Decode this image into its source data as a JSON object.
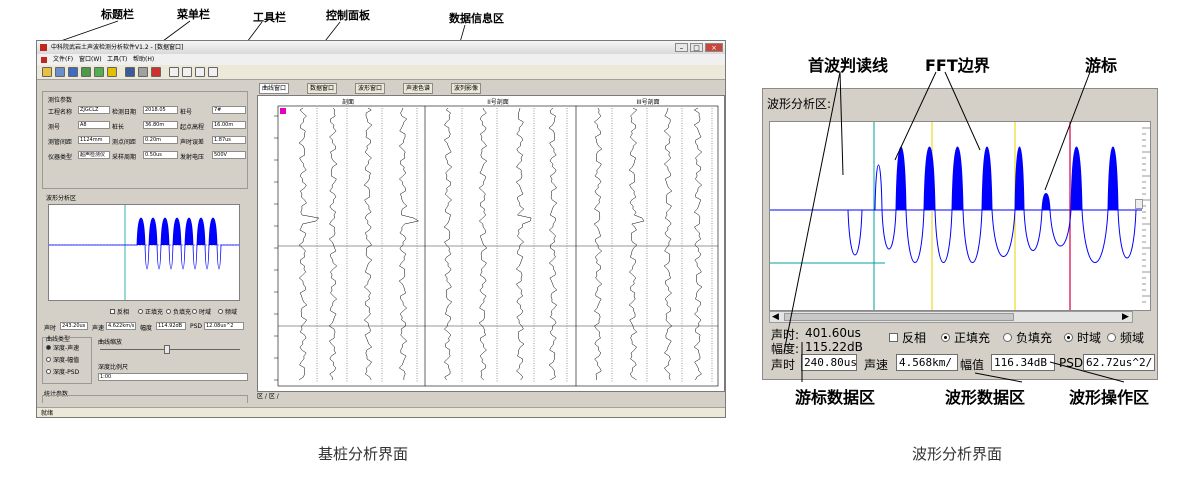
{
  "annotations_left": {
    "title_bar": "标题栏",
    "menu_bar": "菜单栏",
    "toolbar": "工具栏",
    "control_panel": "控制面板",
    "data_info_area": "数据信息区"
  },
  "annotations_right": {
    "first_wave_line": "首波判读线",
    "fft_boundary": "FFT边界",
    "cursor": "游标",
    "cursor_data_area": "游标数据区",
    "wave_data_area": "波形数据区",
    "wave_operation_area": "波形操作区"
  },
  "captions": {
    "left": "基桩分析界面",
    "right": "波形分析界面"
  },
  "left_window": {
    "title": "中科院武岩土声波检测分析软件V1.2 - [数据窗口]",
    "menu": [
      "文件(F)",
      "窗口(W)",
      "工具(T)",
      "帮助(H)"
    ],
    "control": {
      "params_heading": "测位参数",
      "rows": [
        [
          "工程名称",
          "ZJGCLZ",
          "检测日期",
          "2018.05",
          "桩号",
          "7#"
        ],
        [
          "测号",
          "A8",
          "桩长",
          "36.80m",
          "起点高程",
          "16.00m"
        ],
        [
          "测管间距",
          "1124mm",
          "测点间距",
          "0.20m",
          "声时误差",
          "1.87us"
        ],
        [
          "仪器类型",
          "超声检测仪",
          "采样周期",
          "0.50us",
          "发射电压",
          "500V"
        ]
      ],
      "wave_heading": "波形分析区",
      "options": [
        "反相",
        "正填充",
        "负填充",
        "时域",
        "频域"
      ],
      "readout": [
        "声时",
        "243.20us",
        "声速",
        "4.622km/s",
        "幅度",
        "114.92dB",
        "PSD",
        "12.08us^2"
      ],
      "curve_group": "曲线类型",
      "curve_options": [
        "深度-声速",
        "深度-幅值",
        "深度-PSD"
      ],
      "scale_label": "曲线缩放",
      "ratio_label": "深度比例尺",
      "ratio_value": "1:00",
      "stats_heading": "统计参数"
    },
    "data_tabs": [
      "曲线窗口",
      "数据窗口",
      "波形窗口",
      "声速色谱",
      "波列影像"
    ],
    "section_labels": [
      "剖面",
      "II号剖面",
      "III号剖面"
    ],
    "sheet_tabs": "区 / 区 /",
    "status": "就绪"
  },
  "right_window": {
    "wave_title": "波形分析区:",
    "sound_time_label": "声时:",
    "sound_time_value": "401.60us",
    "amplitude_label": "幅度:",
    "amplitude_value": "115.22dB",
    "options": {
      "invert": "反相",
      "positive_fill": "正填充",
      "negative_fill": "负填充",
      "time_domain": "时域",
      "freq_domain": "频域"
    },
    "readout": {
      "time_label": "声时",
      "time_value": "240.80us",
      "speed_label": "声速",
      "speed_value": "4.568km/",
      "amp_label": "幅值",
      "amp_value": "116.34dB",
      "psd_label": "PSD",
      "psd_value": "62.72us^2/"
    }
  },
  "colors": {
    "wave_fill": "#0000ff",
    "first_wave_line": "#00a0a0",
    "fft_boundary": "#e8d000",
    "cursor": "#d0004a",
    "panel_bg": "#d4d0c8",
    "app_icon": "#c0281e"
  }
}
